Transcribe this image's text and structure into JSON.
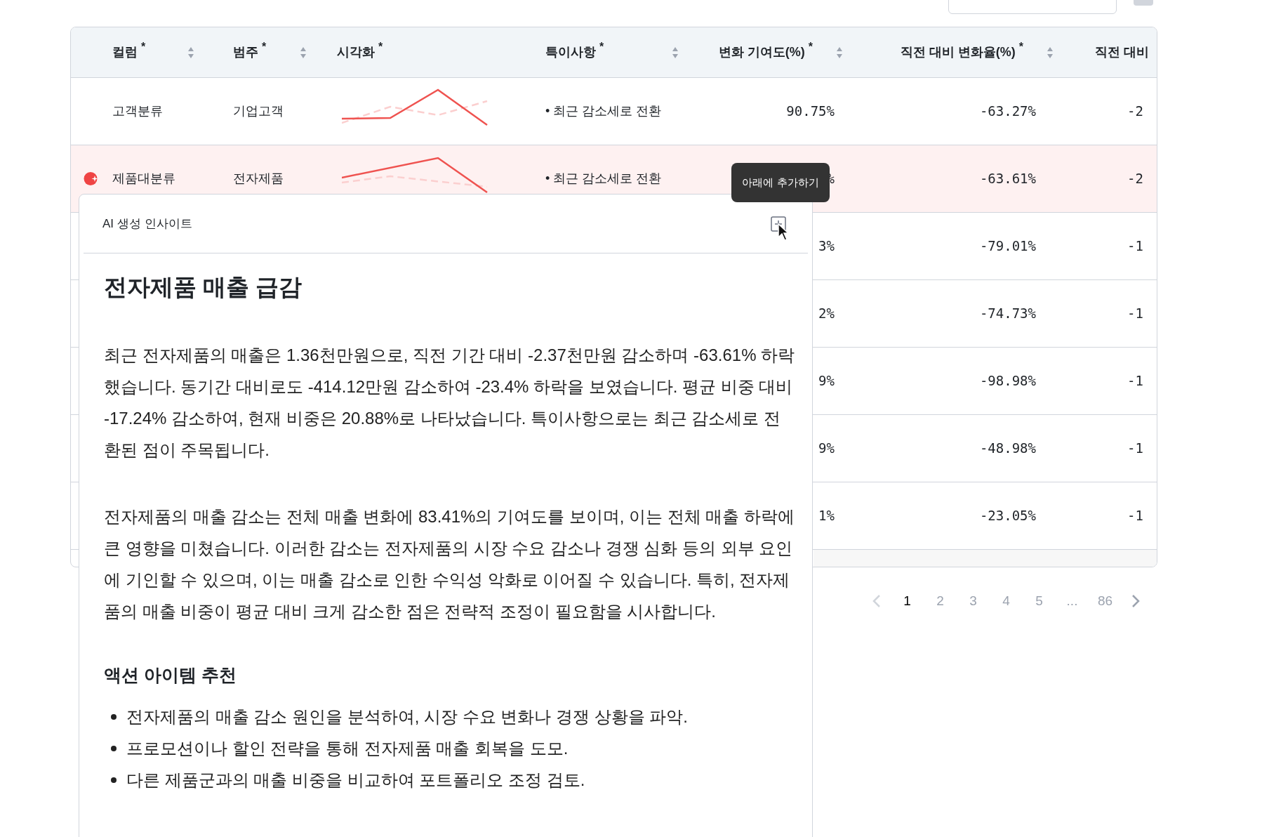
{
  "table": {
    "columns": [
      {
        "label": "컬럼",
        "marker": "*",
        "sortable": true
      },
      {
        "label": "범주",
        "marker": "*",
        "sortable": true
      },
      {
        "label": "시각화",
        "marker": "*",
        "sortable": false
      },
      {
        "label": "특이사항",
        "marker": "*",
        "sortable": true
      },
      {
        "label": "변화 기여도(%)",
        "marker": "*",
        "sortable": true
      },
      {
        "label": "직전 대비 변화율(%)",
        "marker": "*",
        "sortable": true
      },
      {
        "label": "직전 대비",
        "sortable": false
      }
    ],
    "rows": [
      {
        "selected": false,
        "column": "고객분류",
        "category": "기업고객",
        "note": "• 최근 감소세로 전환",
        "contribution": "90.75%",
        "prev_change": "-63.27%",
        "prev_other": "-2"
      },
      {
        "selected": true,
        "column": "제품대분류",
        "category": "전자제품",
        "note": "• 최근 감소세로 전환",
        "contribution": "%",
        "prev_change": "-63.61%",
        "prev_other": "-2"
      },
      {
        "selected": false,
        "contribution": "3%",
        "prev_change": "-79.01%",
        "prev_other": "-1"
      },
      {
        "selected": false,
        "contribution": "2%",
        "prev_change": "-74.73%",
        "prev_other": "-1"
      },
      {
        "selected": false,
        "contribution": "9%",
        "prev_change": "-98.98%",
        "prev_other": "-1"
      },
      {
        "selected": false,
        "contribution": "9%",
        "prev_change": "-48.98%",
        "prev_other": "-1"
      },
      {
        "selected": false,
        "contribution": "1%",
        "prev_change": "-23.05%",
        "prev_other": "-1"
      }
    ]
  },
  "pagination": {
    "pages": [
      {
        "label": "1",
        "selected": true
      },
      {
        "label": "2",
        "selected": false
      },
      {
        "label": "3",
        "selected": false
      },
      {
        "label": "4",
        "selected": false
      },
      {
        "label": "5",
        "selected": false
      },
      {
        "label": "...",
        "selected": false
      },
      {
        "label": "86",
        "selected": false
      }
    ]
  },
  "tooltip": "아래에 추가하기",
  "insight_panel": {
    "header": "AI 생성 인사이트",
    "title": "전자제품 매출 급감",
    "paragraphs": [
      "최근 전자제품의 매출은 1.36천만원으로, 직전 기간 대비 -2.37천만원 감소하며 -63.61% 하락했습니다. 동기간 대비로도 -414.12만원 감소하여 -23.4% 하락을 보였습니다. 평균 비중 대비 -17.24% 감소하여, 현재 비중은 20.88%로 나타났습니다. 특이사항으로는 최근 감소세로 전환된 점이 주목됩니다.",
      "전자제품의 매출 감소는 전체 매출 변화에 83.41%의 기여도를 보이며, 이는 전체 매출 하락에 큰 영향을 미쳤습니다. 이러한 감소는 전자제품의 시장 수요 감소나 경쟁 심화 등의 외부 요인에 기인할 수 있으며, 이는 매출 감소로 인한 수익성 악화로 이어질 수 있습니다. 특히, 전자제품의 매출 비중이 평균 대비 크게 감소한 점은 전략적 조정이 필요함을 시사합니다."
    ],
    "actions_heading": "액션 아이템 추천",
    "actions": [
      "전자제품의 매출 감소 원인을 분석하여, 시장 수요 변화나 경쟁 상황을 파악.",
      "프로모션이나 할인 전략을 통해 전자제품 매출 회복을 도모.",
      "다른 제품군과의 매출 비중을 비교하여 포트폴리오 조정 검토."
    ]
  }
}
